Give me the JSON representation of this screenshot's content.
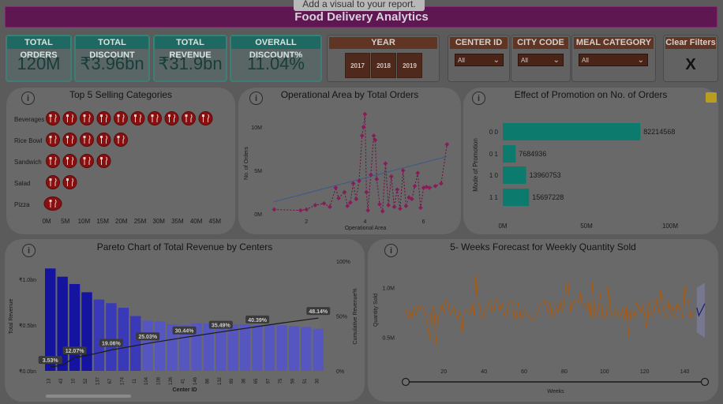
{
  "header": {
    "title": "Food Delivery Analytics",
    "tooltip": "Add a visual to your report."
  },
  "kpis": [
    {
      "label": "TOTAL ORDERS",
      "value": "120M"
    },
    {
      "label": "TOTAL DISCOUNT",
      "value": "₹3.96bn"
    },
    {
      "label": "TOTAL REVENUE",
      "value": "₹31.9bn"
    },
    {
      "label": "OVERALL DISCOUNT%",
      "value": "11.04%"
    }
  ],
  "year_slicer": {
    "label": "YEAR",
    "options": [
      "2017",
      "2018",
      "2019"
    ]
  },
  "center_slicer": {
    "label": "CENTER ID",
    "value": "All"
  },
  "city_slicer": {
    "label": "CITY CODE",
    "value": "All"
  },
  "meal_slicer": {
    "label": "MEAL CATEGORY",
    "value": "All"
  },
  "clear_filters": {
    "label": "Clear Filters",
    "symbol": "X"
  },
  "colors": {
    "title_bar": "#5e1750",
    "kpi_header": "#1e6a62",
    "slicer_header": "#613524",
    "pictogram": "#8a1010",
    "teal_bar": "#0d7a6e",
    "pareto_bar": "#3a3ab8",
    "forecast_line": "#a85a10"
  },
  "top5": {
    "title": "Top 5 Selling Categories",
    "icon": "fork-knife-icon",
    "categories": [
      {
        "name": "Beverages",
        "icons": 10
      },
      {
        "name": "Rice Bowl",
        "icons": 5
      },
      {
        "name": "Sandwich",
        "icons": 4
      },
      {
        "name": "Salad",
        "icons": 2
      },
      {
        "name": "Pizza",
        "icons": 1
      }
    ],
    "xticks": [
      "0M",
      "5M",
      "10M",
      "15M",
      "20M",
      "25M",
      "30M",
      "35M",
      "40M",
      "45M"
    ]
  },
  "operational": {
    "title": "Operational Area by Total Orders",
    "xlabel": "Operational Area",
    "ylabel": "No. of Orders",
    "yticks": [
      "0M",
      "5M",
      "10M"
    ],
    "xticks": [
      "2",
      "4",
      "6"
    ]
  },
  "chart_data": [
    {
      "type": "scatter",
      "title": "Operational Area by Total Orders",
      "xlabel": "Operational Area",
      "ylabel": "No. of Orders",
      "xlim": [
        0.7,
        6.9
      ],
      "ylim": [
        0,
        12
      ],
      "x": [
        0.9,
        1.8,
        2.0,
        2.3,
        2.6,
        2.8,
        3.0,
        3.1,
        3.3,
        3.4,
        3.5,
        3.6,
        3.7,
        3.8,
        3.9,
        3.95,
        4.0,
        4.05,
        4.1,
        4.2,
        4.3,
        4.35,
        4.4,
        4.5,
        4.6,
        4.7,
        4.8,
        4.9,
        5.0,
        5.1,
        5.2,
        5.3,
        5.4,
        5.5,
        5.6,
        5.7,
        5.8,
        5.9,
        6.0,
        6.1,
        6.2,
        6.4,
        6.6,
        6.8
      ],
      "y": [
        0.5,
        0.4,
        0.5,
        1.0,
        1.2,
        0.8,
        3.0,
        1.8,
        2.5,
        0.9,
        1.3,
        3.5,
        1.7,
        3.8,
        9.0,
        10.0,
        11.5,
        2.5,
        0.4,
        4.5,
        9.0,
        8.5,
        4.0,
        1.1,
        0.3,
        5.8,
        1.0,
        4.3,
        0.8,
        2.8,
        0.6,
        5.0,
        0.9,
        1.9,
        1.7,
        3.2,
        4.7,
        0.7,
        3.0,
        3.1,
        3.0,
        3.2,
        3.5,
        8.0
      ],
      "trend": [
        [
          0.9,
          1.4
        ],
        [
          6.8,
          6.6
        ]
      ]
    },
    {
      "type": "bar",
      "title": "Effect of Promotion on No. of Orders",
      "ylabel": "Mode of Promotion",
      "categories": [
        "0 0",
        "0 1",
        "1 0",
        "1 1"
      ],
      "values": [
        82214568,
        7684936,
        13960753,
        15697228
      ],
      "xticks": [
        "0M",
        "50M",
        "100M"
      ],
      "xlim": [
        0,
        100000000
      ]
    },
    {
      "type": "bar",
      "title": "Pareto Chart of Total Revenue by Centers",
      "xlabel": "Center ID",
      "ylabel": "Total Revenue",
      "y2label": "Cumulative Revenue%",
      "yticks": [
        "₹0.0bn",
        "₹0.5bn",
        "₹1.0bn"
      ],
      "y2ticks": [
        "0%",
        "50%",
        "100%"
      ],
      "categories": [
        "13",
        "43",
        "10",
        "52",
        "137",
        "67",
        "174",
        "11",
        "104",
        "108",
        "126",
        "41",
        "146",
        "86",
        "132",
        "89",
        "36",
        "65",
        "97",
        "75",
        "59",
        "51",
        "30"
      ],
      "values": [
        1.12,
        1.03,
        0.95,
        0.86,
        0.78,
        0.74,
        0.69,
        0.6,
        0.55,
        0.54,
        0.51,
        0.5,
        0.52,
        0.52,
        0.52,
        0.51,
        0.51,
        0.5,
        0.5,
        0.5,
        0.49,
        0.48,
        0.46
      ],
      "cumulative_labels": [
        {
          "index": 0,
          "label": "3.53%"
        },
        {
          "index": 2,
          "label": "12.07%"
        },
        {
          "index": 5,
          "label": "19.06%"
        },
        {
          "index": 8,
          "label": "25.03%"
        },
        {
          "index": 11,
          "label": "30.44%"
        },
        {
          "index": 14,
          "label": "35.49%"
        },
        {
          "index": 17,
          "label": "40.39%"
        },
        {
          "index": 22,
          "label": "48.14%"
        }
      ],
      "cumulative": [
        3.53,
        5.2,
        12.07,
        14.0,
        16.5,
        19.06,
        21.0,
        23.0,
        25.03,
        26.8,
        28.6,
        30.44,
        32.1,
        33.8,
        35.49,
        37.1,
        38.7,
        40.39,
        42.0,
        43.6,
        45.1,
        46.6,
        48.14
      ],
      "ylim": [
        0,
        1.2
      ],
      "y2lim": [
        0,
        100
      ]
    },
    {
      "type": "line",
      "title": "5- Weeks Forecast for Weekly Quantity Sold",
      "xlabel": "Weeks",
      "ylabel": "Quantity Sold",
      "yticks": [
        "0.5M",
        "1.0M"
      ],
      "xticks": [
        "20",
        "40",
        "60",
        "80",
        "100",
        "120",
        "140"
      ],
      "xlim": [
        1,
        150
      ],
      "ylim": [
        0.3,
        1.25
      ],
      "forecast_start": 146
    }
  ]
}
